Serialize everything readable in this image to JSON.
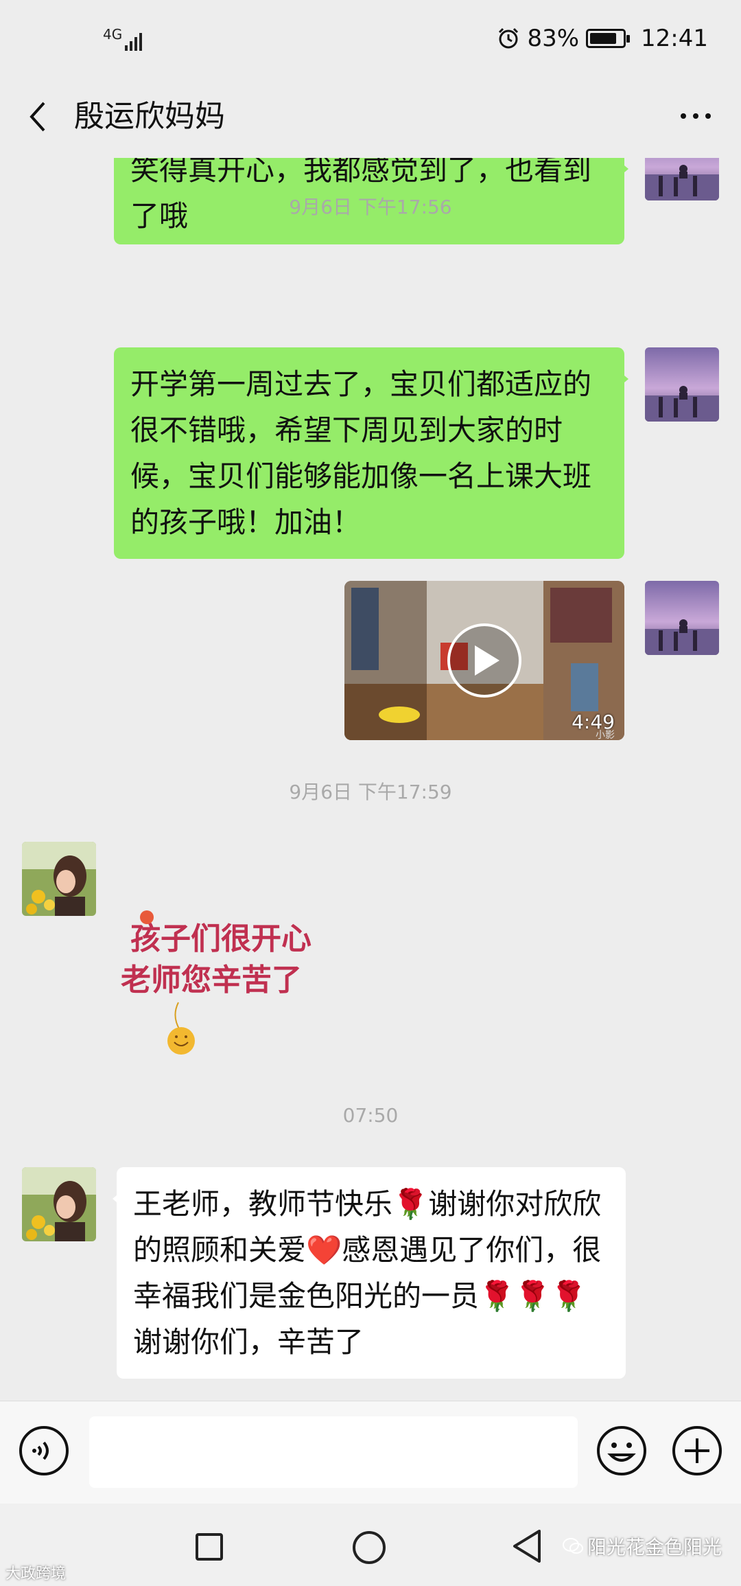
{
  "status_bar": {
    "network": "4G",
    "battery_percent": "83%",
    "battery_level": 0.83,
    "time": "12:41"
  },
  "header": {
    "contact_name": "殷运欣妈妈"
  },
  "messages": [
    {
      "type": "text",
      "sender": "me",
      "text": "笑得真开心，我都感觉到了，也看到了哦"
    },
    {
      "type": "timestamp",
      "text": "9月6日 下午17:56"
    },
    {
      "type": "text",
      "sender": "me",
      "text": "开学第一周过去了，宝贝们都适应的很不错哦，希望下周见到大家的时候，宝贝们能够能加像一名上课大班的孩子哦！加油！"
    },
    {
      "type": "video",
      "sender": "me",
      "duration": "4:49",
      "source_label": "小影"
    },
    {
      "type": "timestamp",
      "text": "9月6日 下午17:59"
    },
    {
      "type": "sticker",
      "sender": "other",
      "line1": "孩子们很开心",
      "line2": "老师您辛苦了"
    },
    {
      "type": "timestamp",
      "text": "07:50"
    },
    {
      "type": "text",
      "sender": "other",
      "text": "王老师，教师节快乐🌹谢谢你对欣欣的照顾和关爱❤️感恩遇见了你们，很幸福我们是金色阳光的一员🌹🌹🌹谢谢你们，辛苦了"
    }
  ],
  "watermarks": {
    "right": "阳光花金色阳光",
    "left": "大政跨境"
  },
  "colors": {
    "my_bubble": "#95ec69",
    "other_bubble": "#ffffff",
    "background": "#ededed"
  }
}
